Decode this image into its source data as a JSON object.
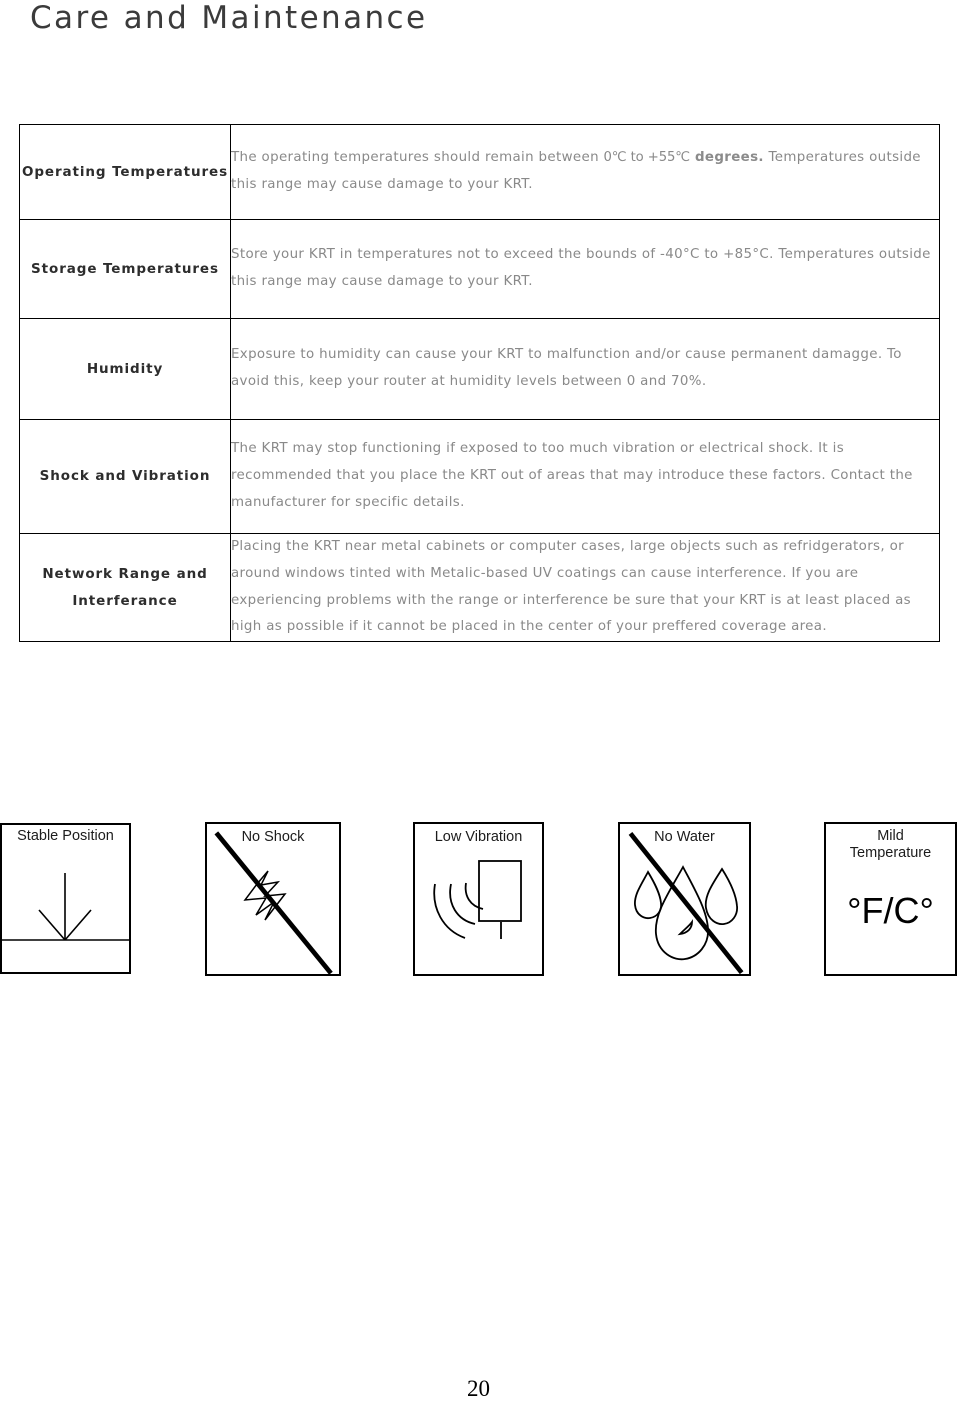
{
  "page": {
    "title": "Care and Maintenance",
    "number": "20"
  },
  "care_table": {
    "rows": [
      {
        "label": "Operating Temperatures",
        "text_a": "The operating temperatures should remain between ",
        "text_b": "0℃ to +55℃",
        "text_c": " degrees.",
        "text_d": "  Temperatures outside this range may cause damage to your KRT."
      },
      {
        "label": "Storage Temperatures",
        "text": "Store your KRT in temperatures not to exceed the bounds of -40°C to +85°C. Temperatures outside this range may cause damage to your KRT."
      },
      {
        "label": "Humidity",
        "text": "Exposure to humidity can cause your KRT to malfunction and/or cause permanent damagge.  To avoid this, keep your router at humidity levels between 0 and 70%."
      },
      {
        "label": "Shock and Vibration",
        "text": "The KRT may stop functioning if exposed to too much vibration or electrical shock.   It is recommended that you place the KRT out of areas that may introduce these factors. Contact the manufacturer for specific details."
      },
      {
        "label": "Network Range and Interferance",
        "label_line1": "Network Range and",
        "label_line2": "Interferance",
        "text": "Placing the KRT near metal cabinets or computer cases, large objects such as refridgerators, or around windows tinted with Metalic-based UV coatings can cause interference. If you are experiencing problems with the range or interference be sure that your KRT is at least placed as high as possible if it cannot be placed in the center of your preffered coverage area."
      }
    ]
  },
  "icons": {
    "stable_position": {
      "caption": "Stable Position",
      "glyph": "down-arrow-on-ground-icon",
      "has_slash": false
    },
    "no_shock": {
      "caption": "No Shock",
      "glyph": "lightning-bolt-icon",
      "has_slash": true
    },
    "low_vibration": {
      "caption": "Low Vibration",
      "glyph": "vibration-waves-icon",
      "has_slash": false
    },
    "no_water": {
      "caption": "No Water",
      "glyph": "water-droplets-icon",
      "has_slash": true
    },
    "mild_temperature": {
      "caption_line1": "Mild",
      "caption_line2": "Temperature",
      "value": "°F/C°",
      "glyph": "temperature-text-icon",
      "has_slash": false
    }
  },
  "colors": {
    "title": "#3b3b3b",
    "label": "#2d2d2d",
    "body": "#898989",
    "rule": "#000000"
  }
}
